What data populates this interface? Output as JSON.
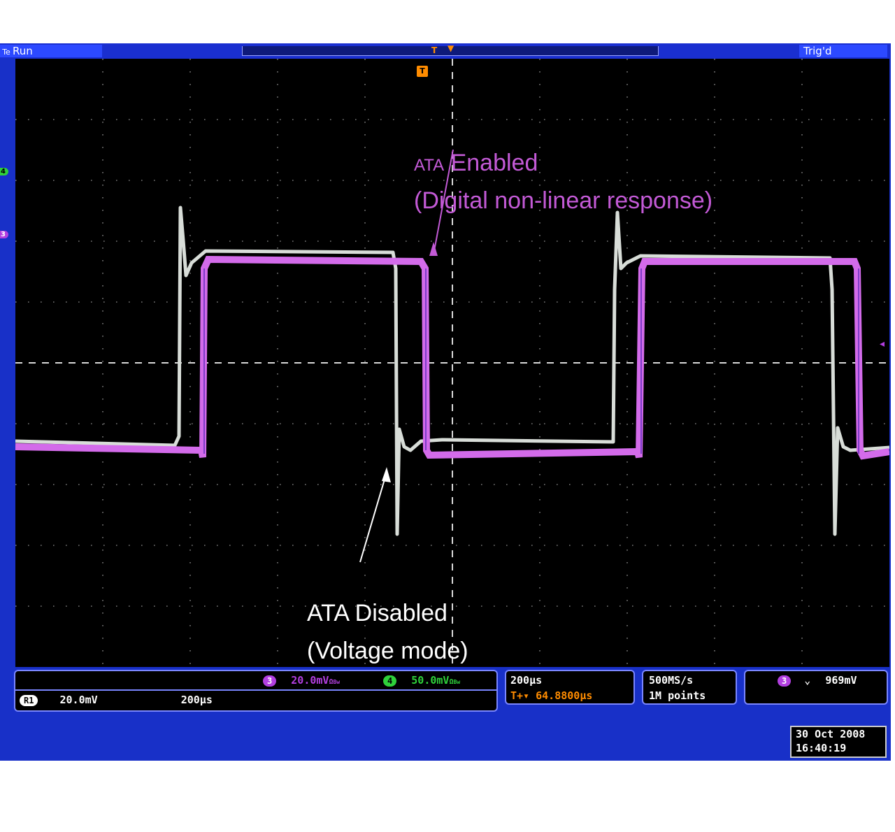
{
  "status": {
    "acq_state": "Run",
    "trigger_state": "Trig'd",
    "channel_tag": "Te"
  },
  "markers": {
    "trigger": "T",
    "ch4": "4",
    "ch3": "3"
  },
  "annotations": {
    "enabled_small": "ATA",
    "enabled_line1": " Enabled",
    "enabled_line2": "(Digital non-linear response)",
    "disabled_line1": "ATA Disabled",
    "disabled_line2": "(Voltage mode)"
  },
  "channels": {
    "ch3": {
      "id": "3",
      "scale": "20.0mV",
      "color": "#b23fe0"
    },
    "ch4": {
      "id": "4",
      "scale": "50.0mV",
      "color": "#2fd13a"
    },
    "ohm": "Ω",
    "bw": "Bw"
  },
  "reference": {
    "id": "R1",
    "scale": "20.0mV",
    "timebase": "200μs"
  },
  "horizontal": {
    "scale": "200μs",
    "delay_prefix": "T+▾",
    "delay": "64.8800μs"
  },
  "acquisition": {
    "rate": "500MS/s",
    "points": "1M points"
  },
  "trigger": {
    "source": "3",
    "slope": "⌄",
    "level": "969mV"
  },
  "timestamp": {
    "date": "30 Oct  2008",
    "time": "16:40:19"
  },
  "colors": {
    "trace_enabled": "#d36bea",
    "trace_disabled": "#d8ddd8",
    "accent": "#ff8c00"
  }
}
